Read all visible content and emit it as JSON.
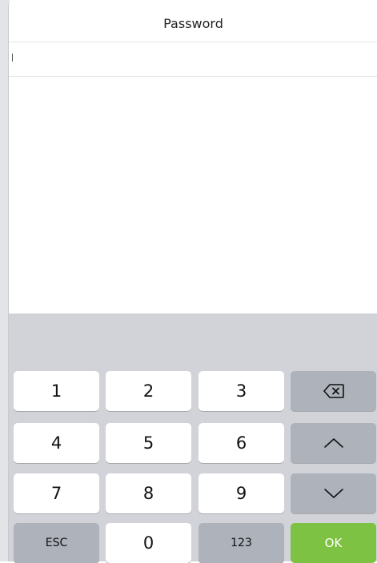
{
  "header": {
    "title": "Password"
  },
  "input": {
    "value": ""
  },
  "keyboard": {
    "keys": {
      "k1": "1",
      "k2": "2",
      "k3": "3",
      "k4": "4",
      "k5": "5",
      "k6": "6",
      "k7": "7",
      "k8": "8",
      "k9": "9",
      "esc": "ESC",
      "k0": "0",
      "mode": "123",
      "ok": "OK"
    },
    "icons": {
      "backspace": "backspace-icon",
      "up": "chevron-up-icon",
      "down": "chevron-down-icon"
    },
    "colors": {
      "ok": "#7dc242",
      "function_key": "#adb2bb",
      "keyboard_bg": "#d2d3d8"
    }
  }
}
